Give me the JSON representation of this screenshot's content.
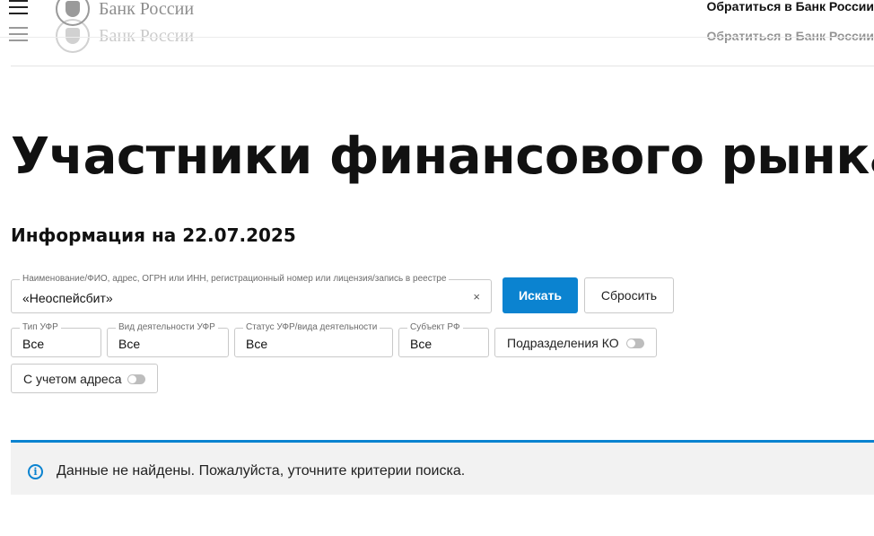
{
  "header": {
    "logo_text": "Банк России",
    "contact_label": "Обратиться в Банк России"
  },
  "page": {
    "title": "Участники финансового рынка",
    "info_date": "Информация на 22.07.2025"
  },
  "search": {
    "label": "Наименование/ФИО, адрес, ОГРН или ИНН, регистрационный номер или лицензия/запись в реестре",
    "value": "«Неоспейсбит»",
    "clear_symbol": "×",
    "search_button": "Искать",
    "reset_button": "Сбросить"
  },
  "filters": {
    "ufr_type": {
      "label": "Тип УФР",
      "value": "Все"
    },
    "activity_type": {
      "label": "Вид деятельности УФР",
      "value": "Все"
    },
    "status": {
      "label": "Статус УФР/вида деятельности",
      "value": "Все"
    },
    "region": {
      "label": "Субъект РФ",
      "value": "Все"
    },
    "branches_toggle": {
      "label": "Подразделения КО",
      "on": false
    },
    "address_toggle": {
      "label": "С учетом адреса",
      "on": false
    }
  },
  "notice": {
    "icon": "info-icon",
    "text": "Данные не найдены. Пожалуйста, уточните критерии поиска."
  },
  "colors": {
    "accent": "#0b83d0",
    "notice_bg": "#f2f2f2"
  }
}
